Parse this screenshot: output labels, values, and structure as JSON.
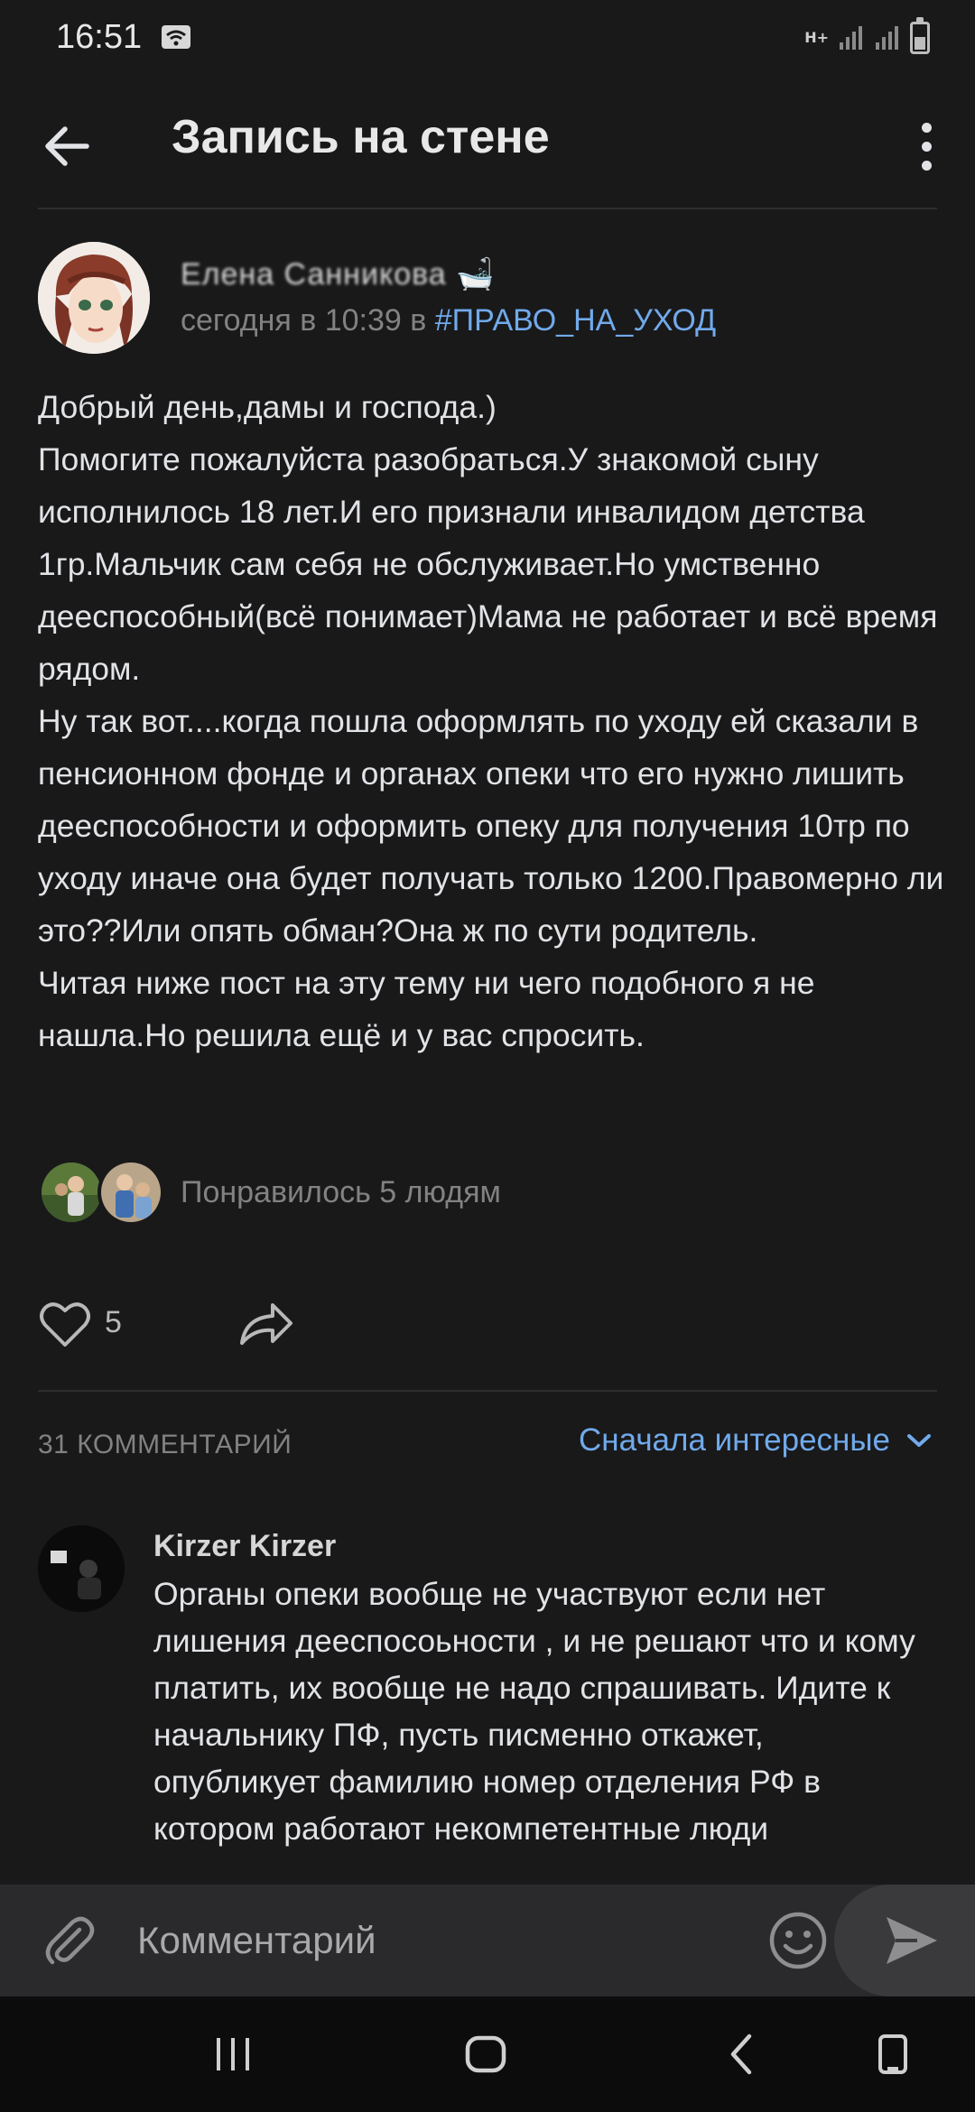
{
  "status_bar": {
    "time": "16:51",
    "network": "H+",
    "icons": [
      "wifi-icon",
      "signal-icon",
      "signal-icon",
      "battery-icon"
    ]
  },
  "header": {
    "title": "Запись на стене",
    "back_icon": "arrow-left-icon",
    "menu_icon": "more-vertical-icon"
  },
  "post": {
    "author": "Елена Санникова",
    "author_emoji": "🛁",
    "date_prefix": "сегодня в 10:39 в ",
    "hashtag": "#ПРАВО_НА_УХОД",
    "text_lines": [
      "Добрый день,дамы и господа.)",
      "Помогите пожалуйста разобраться.У знакомой сыну исполнилось 18 лет.И его признали инвалидом детства 1гр.Мальчик сам себя не обслуживает.Но умственно дееспособный(всё понимает)Мама не работает и всё время рядом.",
      "Ну так вот....когда пошла оформлять по уходу ей сказали в пенсионном фонде и органах опеки что его нужно лишить дееспособности и оформить опеку для получения 10тр по уходу иначе она будет получать только 1200.Правомерно ли это??Или опять обман?Она ж по сути родитель.",
      "Читая ниже пост на эту тему ни чего подобного я не нашла.Но решила ещё и у вас спросить."
    ],
    "liked_by_text": "Понравилось 5 людям",
    "like_count": "5"
  },
  "comments": {
    "count_label": "31 КОММЕНТАРИЙ",
    "sort_label": "Сначала интересные",
    "items": [
      {
        "author": "Kirzer Kirzer",
        "text": "Органы опеки вообще не участвуют если нет лишения дееспосоьности , и не решают что и кому платить, их вообще не надо спрашивать. Идите к начальнику ПФ, пусть писменно откажет, опубликует фамилию номер отделения РФ в котором работают некомпетентные люди"
      }
    ]
  },
  "composer": {
    "placeholder": "Комментарий"
  },
  "colors": {
    "background": "#19191a",
    "accent": "#71aaeb",
    "secondary_text": "#828282"
  }
}
